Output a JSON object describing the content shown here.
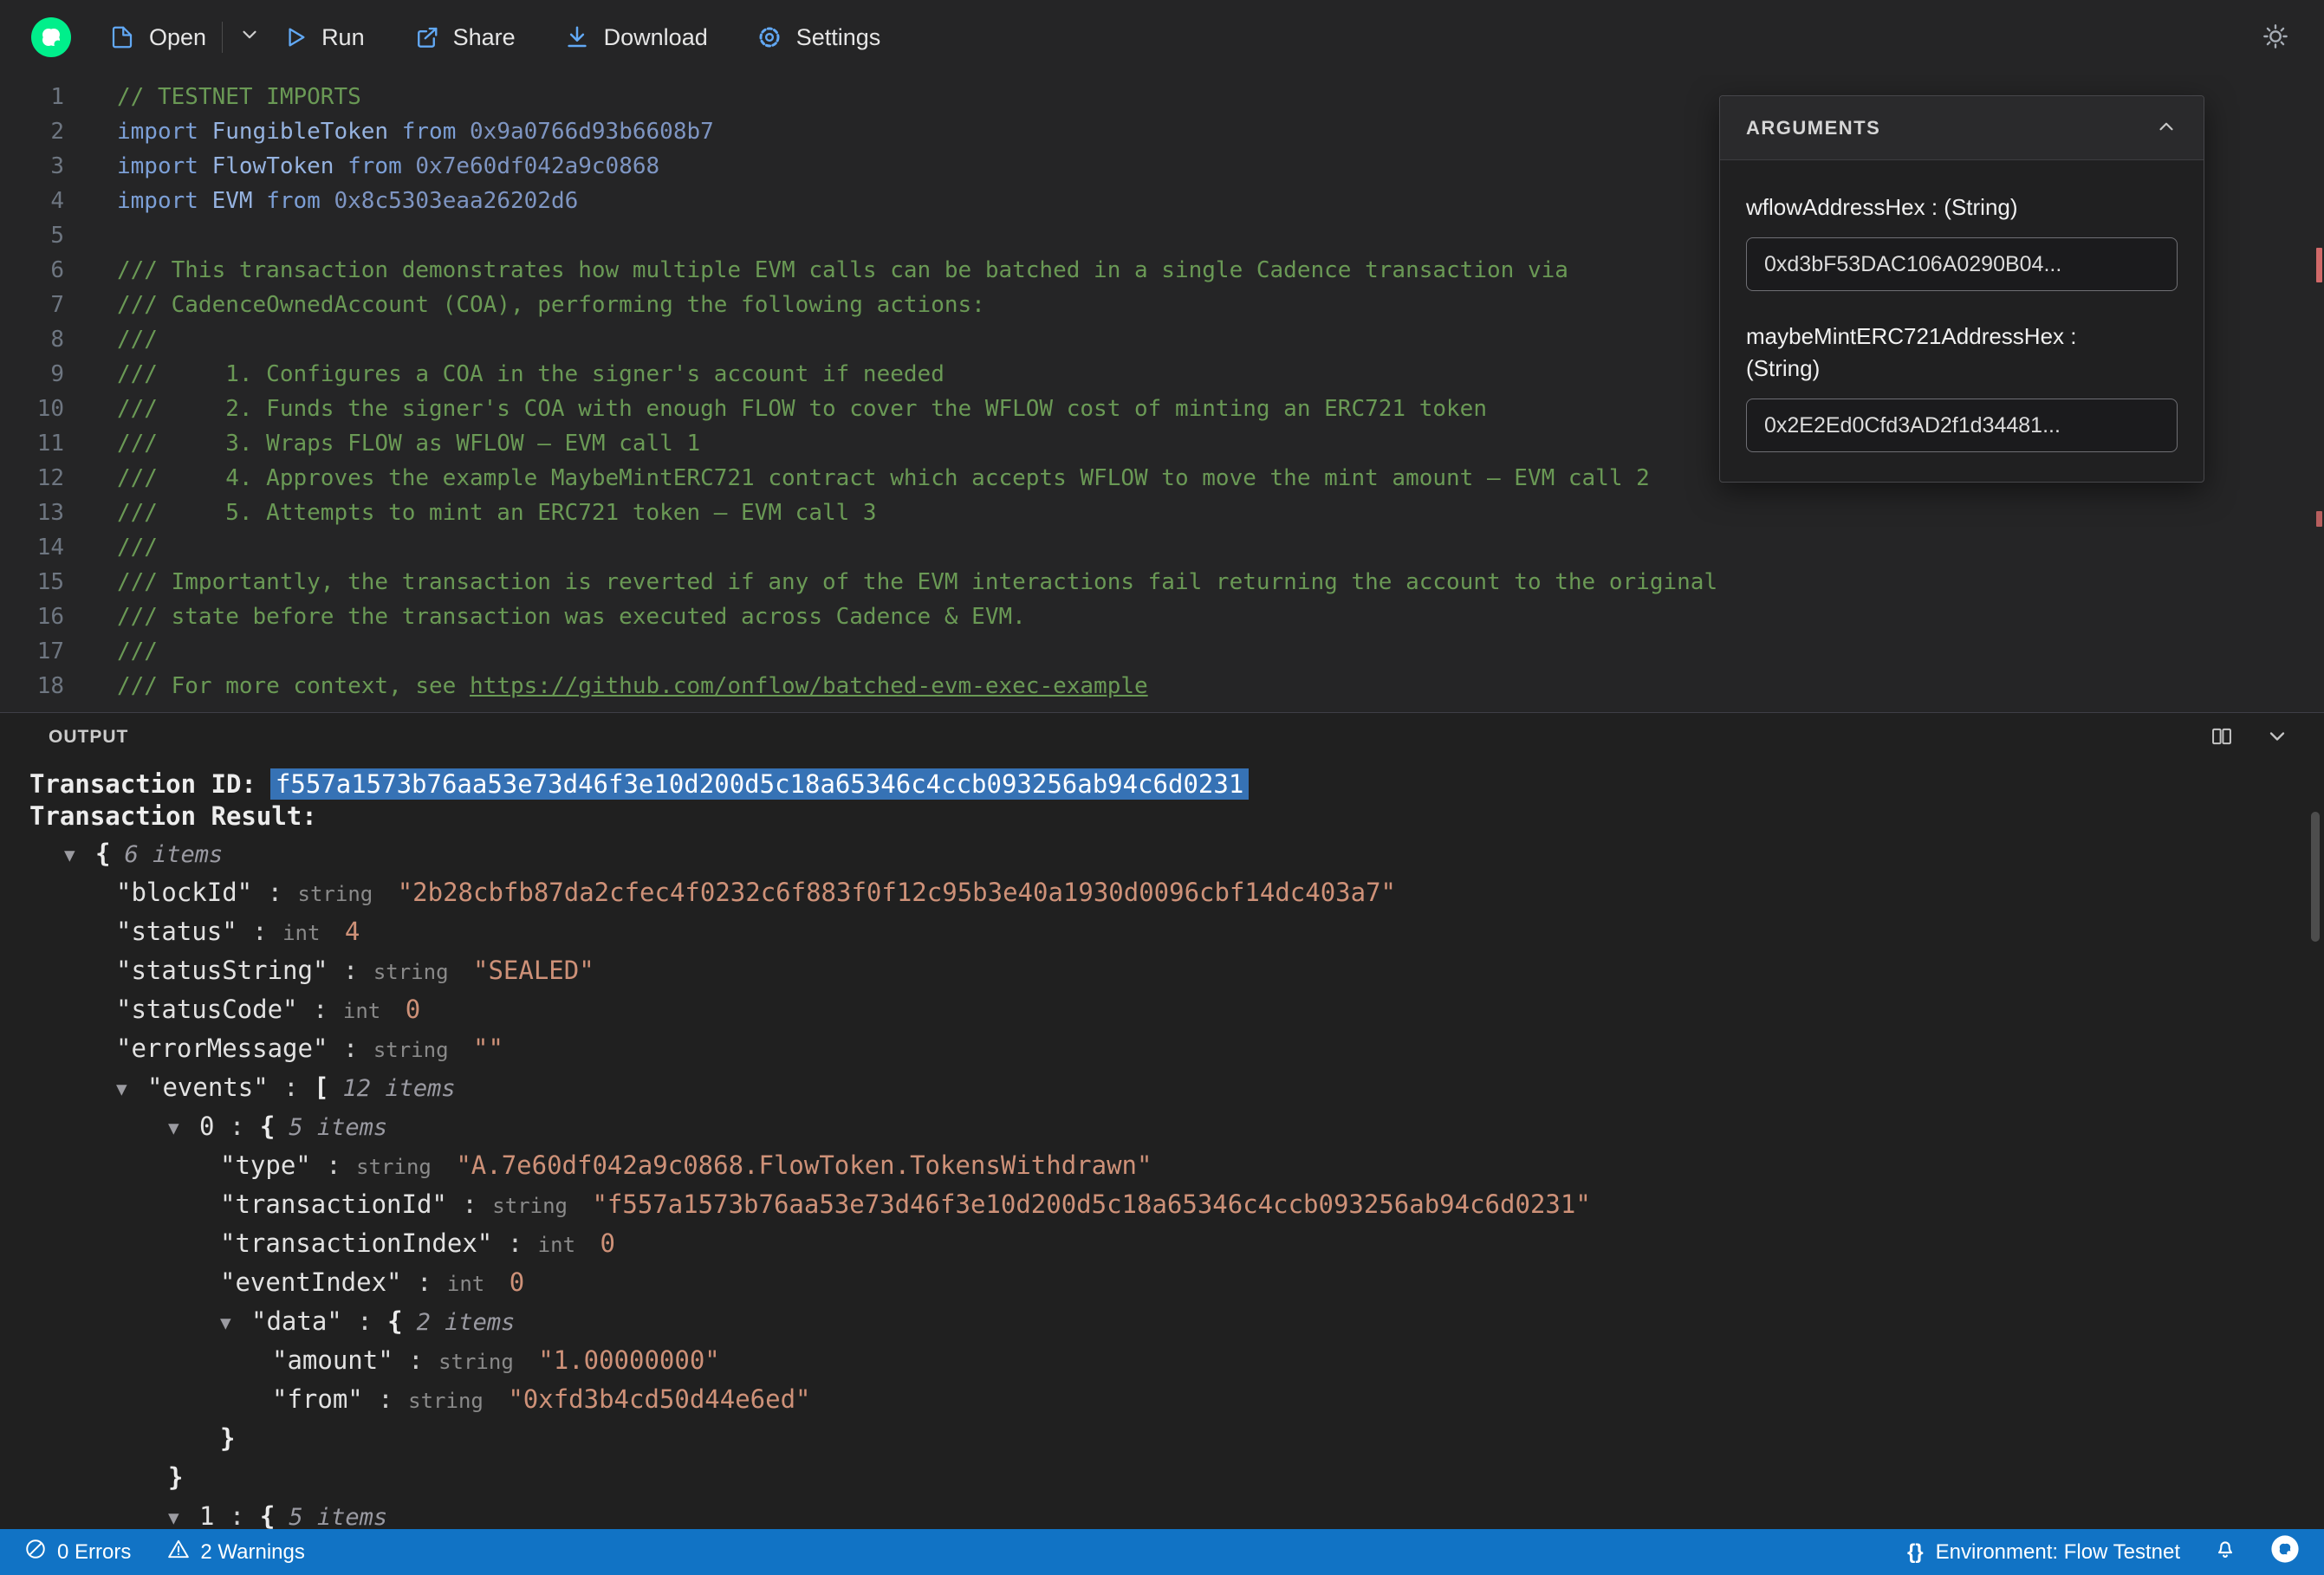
{
  "colors": {
    "flow_green": "#00EF8B",
    "status_bar_blue": "#1173C5",
    "selection_blue": "#3672B5",
    "string_value_orange": "#CE9178",
    "comment_green": "#6A9955"
  },
  "toolbar": {
    "open_label": "Open",
    "run_label": "Run",
    "share_label": "Share",
    "download_label": "Download",
    "settings_label": "Settings"
  },
  "editor": {
    "lines": [
      {
        "n": "1",
        "segs": [
          [
            "comment",
            "// TESTNET IMPORTS"
          ]
        ]
      },
      {
        "n": "2",
        "segs": [
          [
            "kw",
            "import"
          ],
          [
            "plain",
            " "
          ],
          [
            "type",
            "FungibleToken"
          ],
          [
            "plain",
            " "
          ],
          [
            "kw",
            "from"
          ],
          [
            "plain",
            " "
          ],
          [
            "addr",
            "0x9a0766d93b6608b7"
          ]
        ]
      },
      {
        "n": "3",
        "segs": [
          [
            "kw",
            "import"
          ],
          [
            "plain",
            " "
          ],
          [
            "type",
            "FlowToken"
          ],
          [
            "plain",
            " "
          ],
          [
            "kw",
            "from"
          ],
          [
            "plain",
            " "
          ],
          [
            "addr",
            "0x7e60df042a9c0868"
          ]
        ]
      },
      {
        "n": "4",
        "segs": [
          [
            "kw",
            "import"
          ],
          [
            "plain",
            " "
          ],
          [
            "type",
            "EVM"
          ],
          [
            "plain",
            " "
          ],
          [
            "kw",
            "from"
          ],
          [
            "plain",
            " "
          ],
          [
            "addr",
            "0x8c5303eaa26202d6"
          ]
        ]
      },
      {
        "n": "5",
        "segs": []
      },
      {
        "n": "6",
        "segs": [
          [
            "comment",
            "/// This transaction demonstrates how multiple EVM calls can be batched in a single Cadence transaction via"
          ]
        ]
      },
      {
        "n": "7",
        "segs": [
          [
            "comment",
            "/// CadenceOwnedAccount (COA), performing the following actions:"
          ]
        ]
      },
      {
        "n": "8",
        "segs": [
          [
            "comment",
            "///"
          ]
        ]
      },
      {
        "n": "9",
        "segs": [
          [
            "comment",
            "///     1. Configures a COA in the signer's account if needed"
          ]
        ]
      },
      {
        "n": "10",
        "segs": [
          [
            "comment",
            "///     2. Funds the signer's COA with enough FLOW to cover the WFLOW cost of minting an ERC721 token"
          ]
        ]
      },
      {
        "n": "11",
        "segs": [
          [
            "comment",
            "///     3. Wraps FLOW as WFLOW — EVM call 1"
          ]
        ]
      },
      {
        "n": "12",
        "segs": [
          [
            "comment",
            "///     4. Approves the example MaybeMintERC721 contract which accepts WFLOW to move the mint amount — EVM call 2"
          ]
        ]
      },
      {
        "n": "13",
        "segs": [
          [
            "comment",
            "///     5. Attempts to mint an ERC721 token — EVM call 3"
          ]
        ]
      },
      {
        "n": "14",
        "segs": [
          [
            "comment",
            "///"
          ]
        ]
      },
      {
        "n": "15",
        "segs": [
          [
            "comment",
            "/// Importantly, the transaction is reverted if any of the EVM interactions fail returning the account to the original"
          ]
        ]
      },
      {
        "n": "16",
        "segs": [
          [
            "comment",
            "/// state before the transaction was executed across Cadence & EVM."
          ]
        ]
      },
      {
        "n": "17",
        "segs": [
          [
            "comment",
            "///"
          ]
        ]
      },
      {
        "n": "18",
        "segs": [
          [
            "comment",
            "/// For more context, see "
          ],
          [
            "link",
            "https://github.com/onflow/batched-evm-exec-example"
          ]
        ]
      }
    ]
  },
  "arguments_panel": {
    "title": "ARGUMENTS",
    "fields": [
      {
        "label": "wflowAddressHex : (String)",
        "value": "0xd3bF53DAC106A0290B04..."
      },
      {
        "label": "maybeMintERC721AddressHex : (String)",
        "value": "0x2E2Ed0Cfd3AD2f1d34481..."
      }
    ]
  },
  "output": {
    "title": "OUTPUT",
    "transaction_id_label": "Transaction ID:",
    "transaction_id": "f557a1573b76aa53e73d46f3e10d200d5c18a65346c4ccb093256ab94c6d0231",
    "transaction_result_label": "Transaction Result:",
    "tree": [
      {
        "ind": 0,
        "arrow": true,
        "brace": "{",
        "items": "6 items"
      },
      {
        "ind": 1,
        "key": "\"blockId\"",
        "type": "string",
        "value": "\"2b28cbfb87da2cfec4f0232c6f883f0f12c95b3e40a1930d0096cbf14dc403a7\""
      },
      {
        "ind": 1,
        "key": "\"status\"",
        "type": "int",
        "value": "4"
      },
      {
        "ind": 1,
        "key": "\"statusString\"",
        "type": "string",
        "value": "\"SEALED\""
      },
      {
        "ind": 1,
        "key": "\"statusCode\"",
        "type": "int",
        "value": "0"
      },
      {
        "ind": 1,
        "key": "\"errorMessage\"",
        "type": "string",
        "value": "\"\""
      },
      {
        "ind": 1,
        "arrow": true,
        "key": "\"events\"",
        "brace": "[",
        "items": "12 items"
      },
      {
        "ind": 2,
        "arrow": true,
        "key": "0",
        "brace": "{",
        "items": "5 items"
      },
      {
        "ind": 3,
        "key": "\"type\"",
        "type": "string",
        "value": "\"A.7e60df042a9c0868.FlowToken.TokensWithdrawn\""
      },
      {
        "ind": 3,
        "key": "\"transactionId\"",
        "type": "string",
        "value": "\"f557a1573b76aa53e73d46f3e10d200d5c18a65346c4ccb093256ab94c6d0231\""
      },
      {
        "ind": 3,
        "key": "\"transactionIndex\"",
        "type": "int",
        "value": "0"
      },
      {
        "ind": 3,
        "key": "\"eventIndex\"",
        "type": "int",
        "value": "0"
      },
      {
        "ind": 3,
        "arrow": true,
        "key": "\"data\"",
        "brace": "{",
        "items": "2 items"
      },
      {
        "ind": 4,
        "key": "\"amount\"",
        "type": "string",
        "value": "\"1.00000000\""
      },
      {
        "ind": 4,
        "key": "\"from\"",
        "type": "string",
        "value": "\"0xfd3b4cd50d44e6ed\""
      },
      {
        "ind": 3,
        "brace": "}"
      },
      {
        "ind": 2,
        "brace": "}"
      },
      {
        "ind": 2,
        "arrow": true,
        "key": "1",
        "brace": "{",
        "items": "5 items"
      }
    ]
  },
  "status_bar": {
    "errors": "0 Errors",
    "warnings": "2 Warnings",
    "braces": "{}",
    "environment": "Environment: Flow Testnet"
  }
}
